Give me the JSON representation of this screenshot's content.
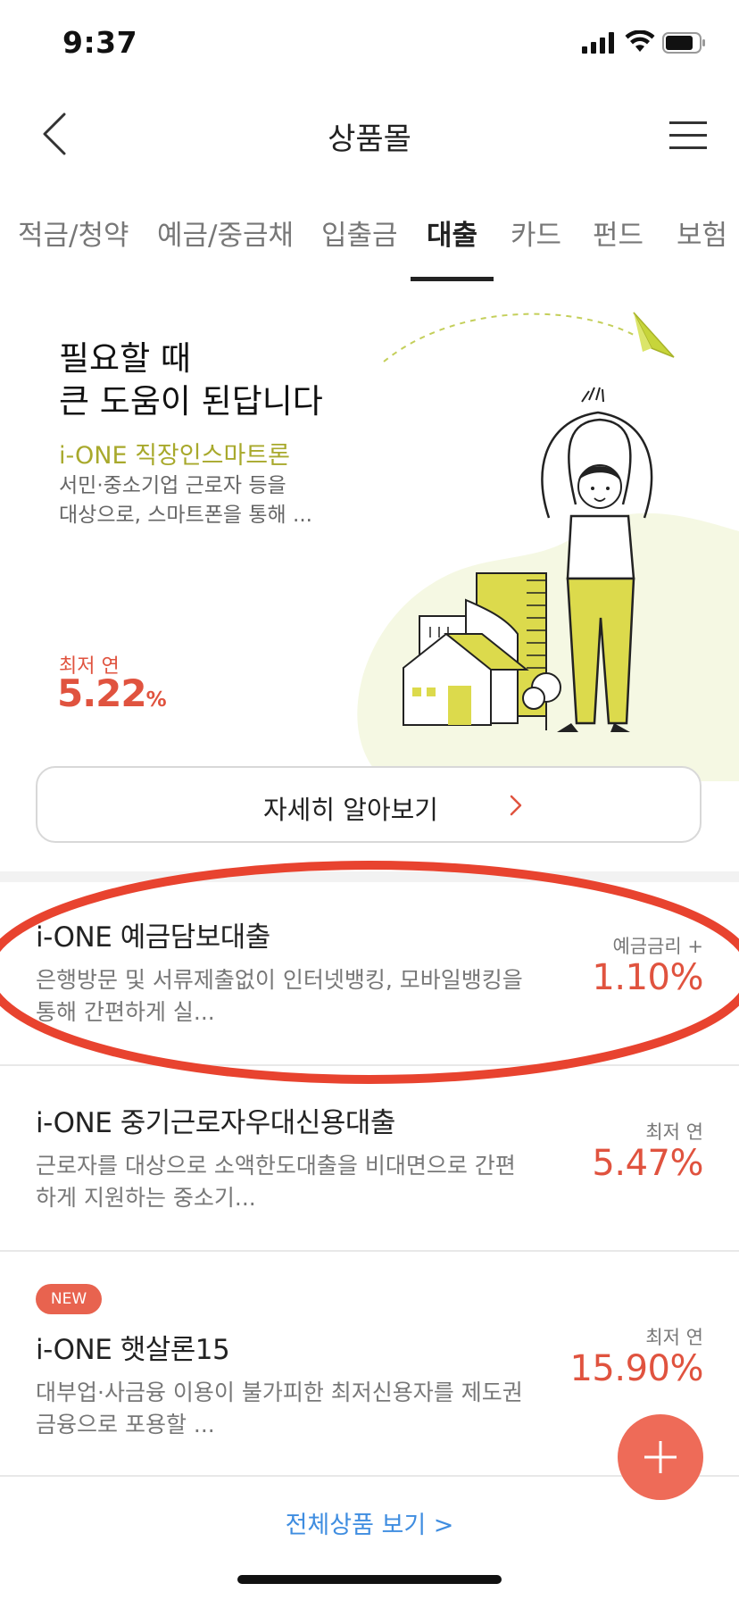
{
  "status_bar": {
    "time": "9:37"
  },
  "nav": {
    "title": "상품몰",
    "back_icon": "chevron-left-icon",
    "menu_icon": "hamburger-menu-icon"
  },
  "tabs": [
    {
      "label": "적금/청약",
      "active": false
    },
    {
      "label": "예금/중금채",
      "active": false
    },
    {
      "label": "입출금",
      "active": false
    },
    {
      "label": "대출",
      "active": true
    },
    {
      "label": "카드",
      "active": false
    },
    {
      "label": "펀드",
      "active": false
    },
    {
      "label": "보험",
      "active": false
    }
  ],
  "hero": {
    "headline": [
      "필요할 때",
      "큰 도움이 된답니다"
    ],
    "product_name": "i-ONE 직장인스마트론",
    "description": [
      "서민·중소기업 근로자 등을",
      "대상으로, 스마트폰을 통해 ..."
    ],
    "rate_label": "최저 연",
    "rate_value": "5.22",
    "rate_unit": "%",
    "detail_button": "자세히 알아보기"
  },
  "products": [
    {
      "name": "i-ONE 예금담보대출",
      "description": [
        "은행방문 및 서류제출없이 인터넷뱅킹, 모바일뱅킹을",
        "통해 간편하게 실..."
      ],
      "rate_label": "예금금리 +",
      "rate": "1.10%",
      "badge": ""
    },
    {
      "name": "i-ONE 중기근로자우대신용대출",
      "description": [
        "근로자를 대상으로 소액한도대출을 비대면으로 간편",
        "하게 지원하는 중소기..."
      ],
      "rate_label": "최저 연",
      "rate": "5.47%",
      "badge": ""
    },
    {
      "name": "i-ONE 햇살론15",
      "description": [
        "대부업·사금융 이용이 불가피한 최저신용자를 제도권",
        "금융으로 포용할 ..."
      ],
      "rate_label": "최저 연",
      "rate": "15.90%",
      "badge": "NEW"
    }
  ],
  "all_products_link": "전체상품 보기 >",
  "colors": {
    "accent_red": "#e0533f",
    "accent_olive": "#a8a92c",
    "link_blue": "#3f8de0",
    "fab": "#ee6b58",
    "highlight": "#e8432f"
  }
}
